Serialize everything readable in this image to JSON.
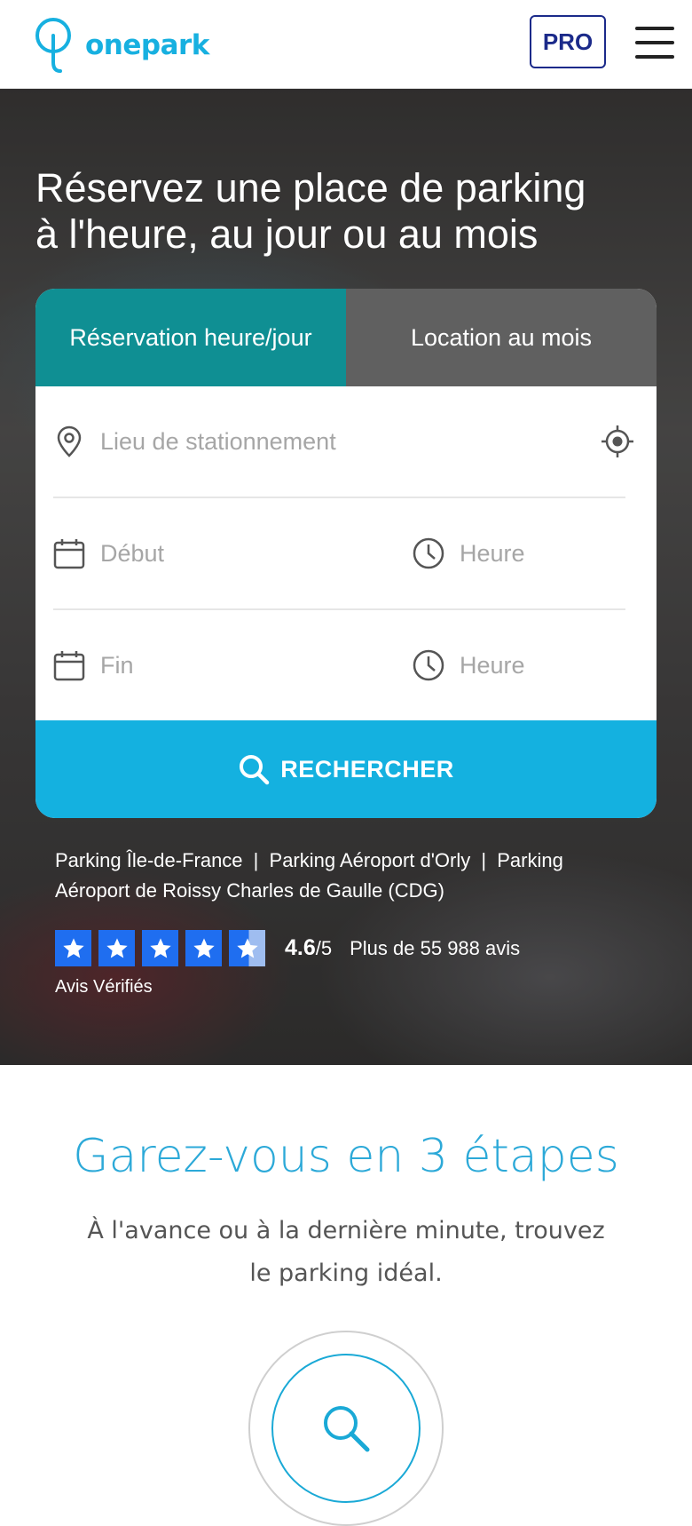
{
  "header": {
    "brand": "onepark",
    "pro_label": "PRO",
    "menu_icon": "hamburger-icon"
  },
  "hero": {
    "title_line1": "Réservez une place de parking",
    "title_line2": "à l'heure, au jour ou au mois",
    "tabs": [
      {
        "label": "Réservation heure/jour",
        "active": true
      },
      {
        "label": "Location au mois",
        "active": false
      }
    ],
    "form": {
      "location_placeholder": "Lieu de stationnement",
      "start_date_placeholder": "Début",
      "start_time_placeholder": "Heure",
      "end_date_placeholder": "Fin",
      "end_time_placeholder": "Heure"
    },
    "search_label": "RECHERCHER",
    "links": [
      "Parking Île-de-France",
      "Parking Aéroport d'Orly",
      "Parking Aéroport de Roissy Charles de Gaulle (CDG)"
    ],
    "link_separator": "|",
    "rating": {
      "score": "4.6",
      "out_of": "/5",
      "stars_value": 4.6,
      "reviews": "Plus de 55 988 avis",
      "source": "Avis Vérifiés"
    }
  },
  "section": {
    "title": "Garez-vous en 3 étapes",
    "subtitle": "À l'avance ou à la dernière minute, trouvez le parking idéal.",
    "step1_icon": "search-icon"
  },
  "colors": {
    "brand_blue": "#17b0e0",
    "tab_active": "#0f8f93",
    "tab_inactive": "#606060",
    "pro_navy": "#1b2a8a",
    "star_blue": "#1f6ef0"
  }
}
